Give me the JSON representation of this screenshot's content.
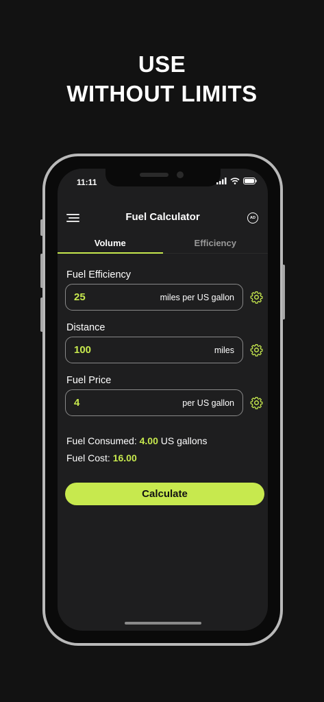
{
  "promo": {
    "line1": "USE",
    "line2": "WITHOUT LIMITS"
  },
  "status_bar": {
    "time": "11:11"
  },
  "app_bar": {
    "title": "Fuel Calculator",
    "ad_badge": "AD"
  },
  "tabs": [
    {
      "label": "Volume",
      "active": true
    },
    {
      "label": "Efficiency",
      "active": false
    }
  ],
  "fields": {
    "efficiency": {
      "label": "Fuel Efficiency",
      "value": "25",
      "unit": "miles per US gallon"
    },
    "distance": {
      "label": "Distance",
      "value": "100",
      "unit": "miles"
    },
    "price": {
      "label": "Fuel Price",
      "value": "4",
      "unit": "per US gallon"
    }
  },
  "results": {
    "consumed_label": "Fuel Consumed:",
    "consumed_value": "4.00",
    "consumed_unit": "US gallons",
    "cost_label": "Fuel Cost:",
    "cost_value": "16.00"
  },
  "actions": {
    "calculate_label": "Calculate"
  },
  "icons": {
    "menu": "menu-icon",
    "ad": "ad-badge-icon",
    "settings": "gear-icon",
    "signal": "signal-icon",
    "wifi": "wifi-icon",
    "battery": "battery-icon"
  },
  "colors": {
    "accent": "#c7e94e",
    "background": "#121212",
    "screen": "#1e1e1f",
    "frame": "#b9b9b9"
  }
}
